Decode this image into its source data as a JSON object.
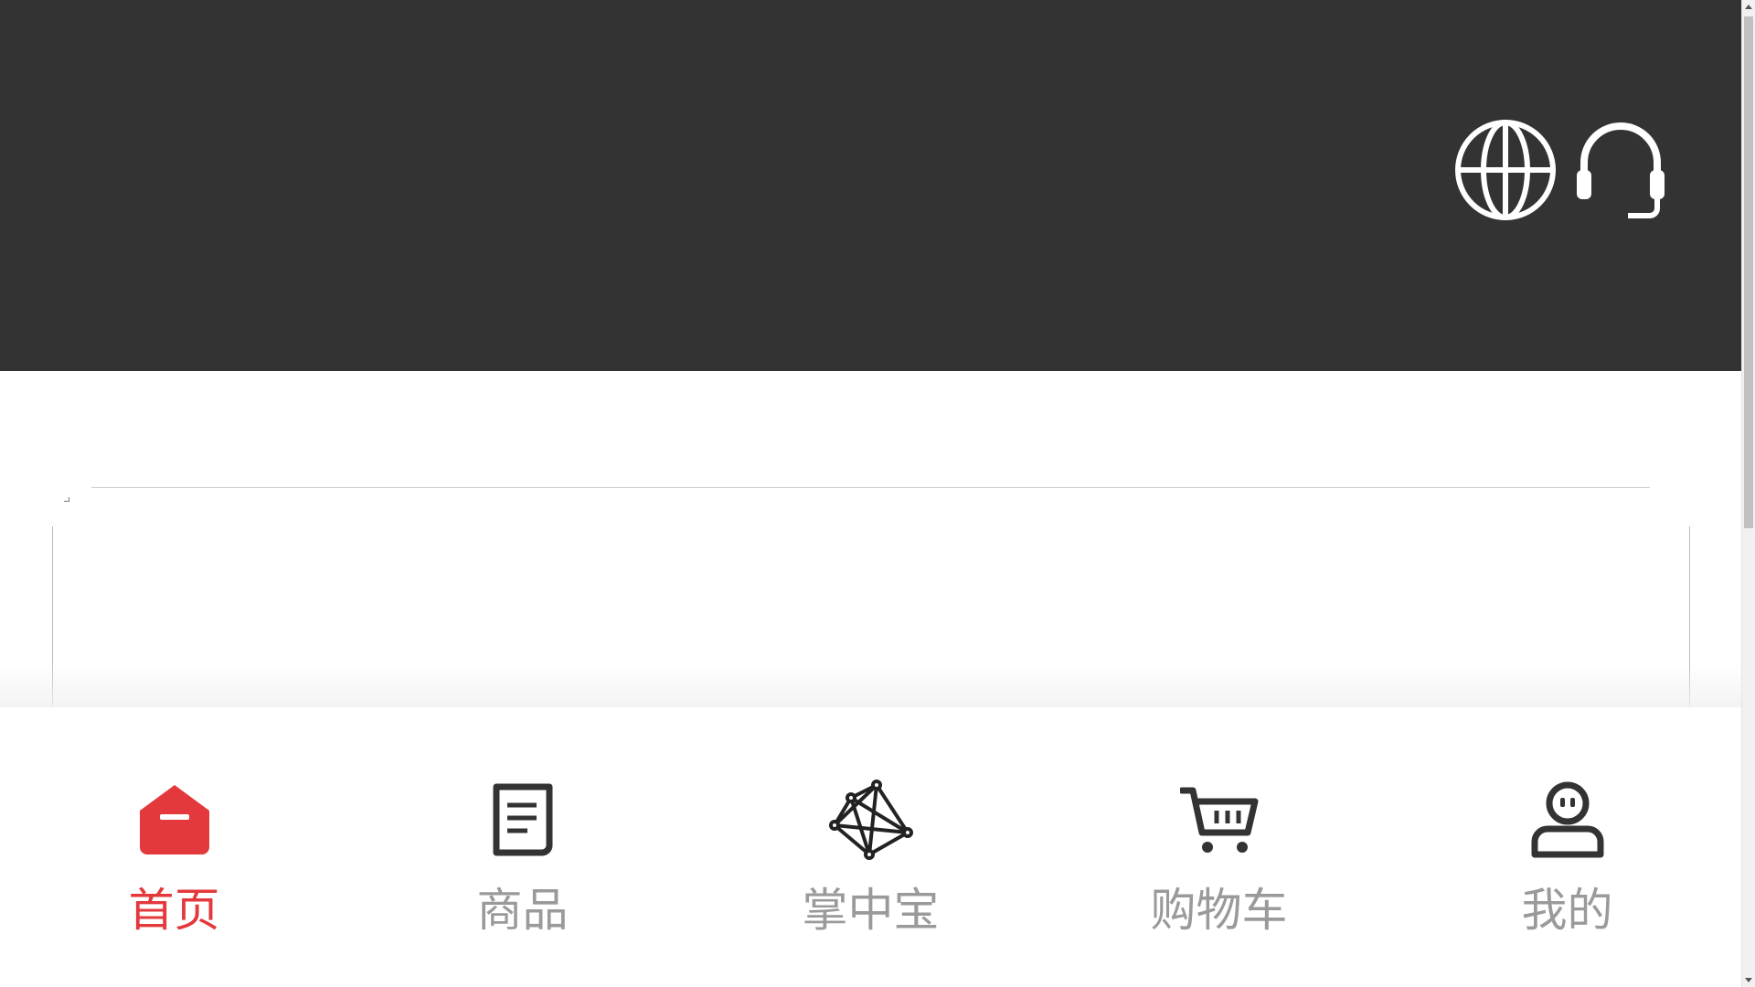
{
  "header": {
    "icons": [
      "globe-icon",
      "headset-icon"
    ]
  },
  "tabbar": {
    "active_color": "#e4393c",
    "inactive_color": "#9a9a9a",
    "items": [
      {
        "label": "首页",
        "icon": "home-icon",
        "active": true
      },
      {
        "label": "商品",
        "icon": "document-icon",
        "active": false
      },
      {
        "label": "掌中宝",
        "icon": "network-icon",
        "active": false
      },
      {
        "label": "购物车",
        "icon": "cart-icon",
        "active": false
      },
      {
        "label": "我的",
        "icon": "user-icon",
        "active": false
      }
    ]
  },
  "colors": {
    "header_bg": "#333333",
    "page_bg": "#ffffff"
  }
}
